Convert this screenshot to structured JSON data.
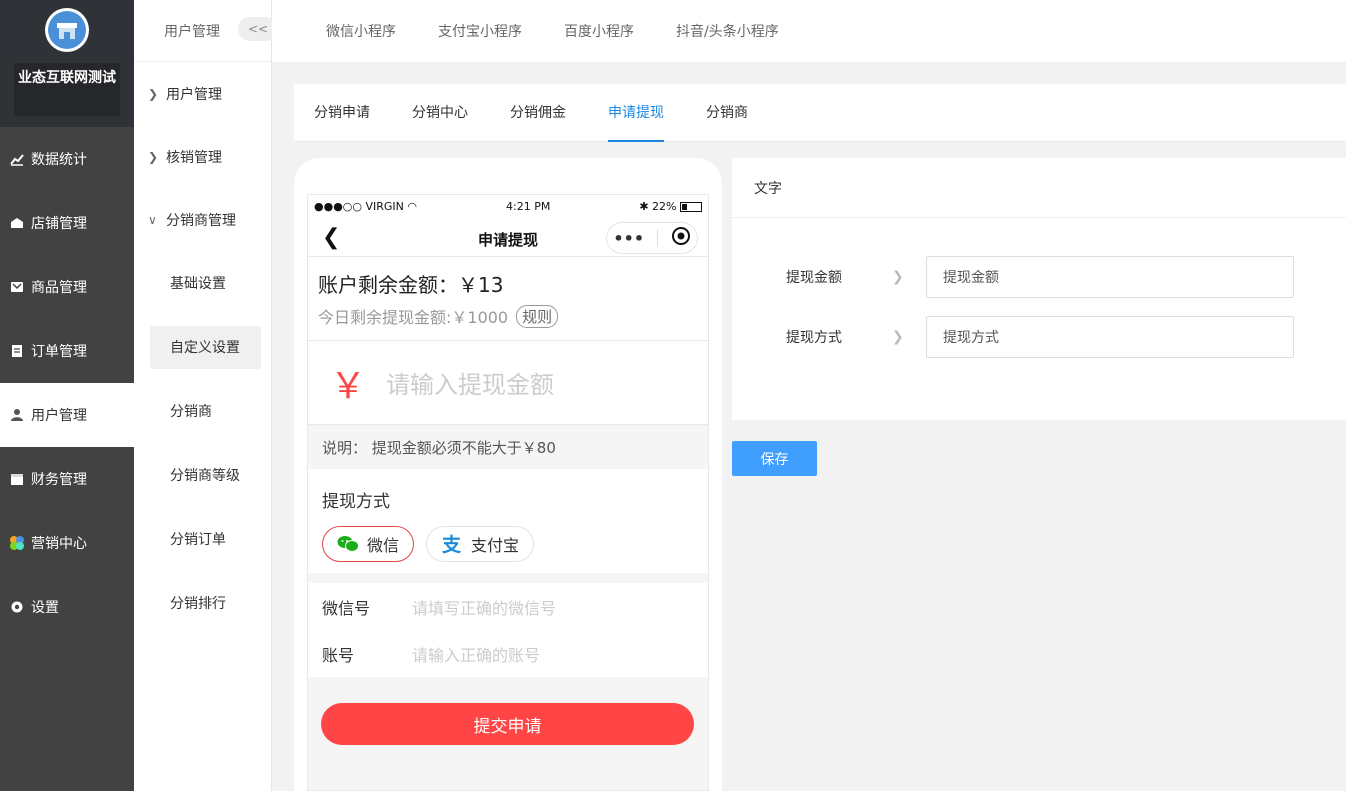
{
  "brand": {
    "name": "业态互联网测试"
  },
  "sidebar": {
    "items": [
      {
        "label": "数据统计",
        "icon": "chart-icon"
      },
      {
        "label": "店铺管理",
        "icon": "store-icon"
      },
      {
        "label": "商品管理",
        "icon": "goods-icon"
      },
      {
        "label": "订单管理",
        "icon": "order-icon"
      },
      {
        "label": "用户管理",
        "icon": "user-icon",
        "active": true
      },
      {
        "label": "财务管理",
        "icon": "finance-icon"
      },
      {
        "label": "营销中心",
        "icon": "marketing-icon"
      },
      {
        "label": "设置",
        "icon": "gear-icon"
      }
    ]
  },
  "subsidebar": {
    "title": "用户管理",
    "collapse": "<<",
    "groups": [
      {
        "label": "用户管理",
        "arrow": ">"
      },
      {
        "label": "核销管理",
        "arrow": ">"
      },
      {
        "label": "分销商管理",
        "arrow": "v"
      }
    ],
    "leaves": [
      "基础设置",
      "自定义设置",
      "分销商",
      "分销商等级",
      "分销订单",
      "分销排行"
    ],
    "active_leaf": "自定义设置"
  },
  "topbar": {
    "tabs": [
      "微信小程序",
      "支付宝小程序",
      "百度小程序",
      "抖音/头条小程序"
    ]
  },
  "subtabs": {
    "items": [
      "分销申请",
      "分销中心",
      "分销佣金",
      "申请提现",
      "分销商"
    ],
    "active": "申请提现"
  },
  "phone": {
    "status": {
      "carrier": "●●●○○ VIRGIN",
      "time": "4:21 PM",
      "battery": "22%"
    },
    "nav_title": "申请提现",
    "balance_label": "账户剩余金额：￥13",
    "today_label": "今日剩余提现金额:￥1000",
    "rule": "规则",
    "yen": "￥",
    "amount_placeholder": "请输入提现金额",
    "note": "说明： 提现金额必须不能大于￥80",
    "method_title": "提现方式",
    "options": [
      "微信",
      "支付宝"
    ],
    "fields": [
      {
        "label": "微信号",
        "placeholder": "请填写正确的微信号"
      },
      {
        "label": "账号",
        "placeholder": "请输入正确的账号"
      }
    ],
    "submit": "提交申请"
  },
  "panel": {
    "title": "文字",
    "rows": [
      {
        "label": "提现金额",
        "value": "提现金额"
      },
      {
        "label": "提现方式",
        "value": "提现方式"
      }
    ],
    "save": "保存"
  },
  "colors": {
    "accent": "#409eff",
    "brand_red": "#ff4545",
    "sidebar_bg": "#424242"
  }
}
